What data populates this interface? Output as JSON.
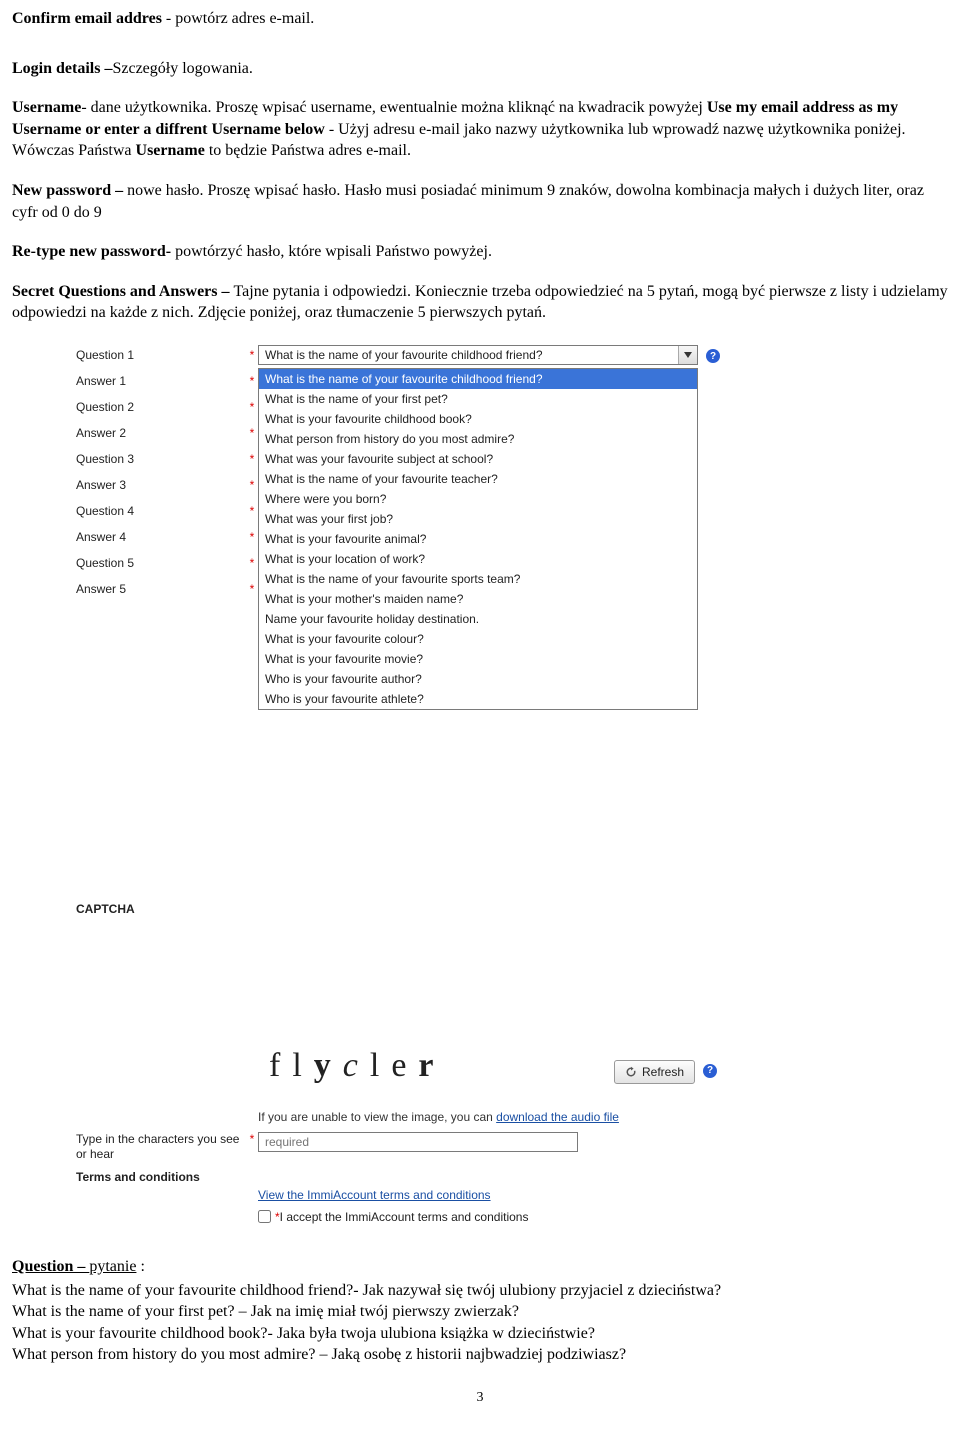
{
  "doc": {
    "line1_bold": "Confirm email addres",
    "line1_rest": " - powtórz adres e-mail.",
    "line2_bold": "Login details –",
    "line2_rest": "Szczegóły logowania.",
    "para3_prefix_bold": "Username",
    "para3_mid": "- dane użytkownika. Proszę wpisać username, ewentualnie można kliknąć na kwadracik powyżej ",
    "para3_bold2": "Use my email address as my Username or enter a diffrent Username below",
    "para3_mid2": " - Użyj adresu e-mail jako nazwy użytkownika lub wprowadź nazwę użytkownika poniżej. Wówczas Państwa ",
    "para3_bold3": "Username",
    "para3_rest": " to będzie Państwa adres e-mail.",
    "para4_bold": "New password – ",
    "para4_rest": "nowe hasło. Proszę wpisać hasło. Hasło musi posiadać minimum 9 znaków, dowolna kombinacja małych i dużych liter, oraz cyfr od 0 do 9",
    "para5_bold": "Re-type new password-",
    "para5_rest": " powtórzyć hasło, które wpisali Państwo powyżej.",
    "para6_bold": "Secret Questions and Answers – ",
    "para6_rest": "Tajne pytania i odpowiedzi. Koniecznie trzeba odpowiedzieć na 5 pytań, mogą być pierwsze z listy i udzielamy odpowiedzi na każde z nich. Zdjęcie poniżej, oraz tłumaczenie 5 pierwszych pytań.",
    "q_header_bold": "Question – ",
    "q_header_rest": "pytanie",
    "q_colon": " :",
    "q1": "What is the name of your favourite childhood friend?- Jak nazywał się twój ulubiony przyjaciel z dzieciństwa?",
    "q2": "What is the name of your first pet? – Jak na imię miał twój pierwszy zwierzak?",
    "q3": "What is your favourite childhood book?- Jaka była twoja ulubiona książka w dzieciństwie?",
    "q4": "What person from history do you most admire? – Jaką osobę z historii najbwadziej podziwiasz?",
    "page_num": "3"
  },
  "form": {
    "labels": [
      "Question 1",
      "Answer 1",
      "Question 2",
      "Answer 2",
      "Question 3",
      "Answer 3",
      "Question 4",
      "Answer 4",
      "Question 5",
      "Answer 5"
    ],
    "selected": "What is the name of your favourite childhood friend?",
    "options": [
      "What is the name of your favourite childhood friend?",
      "What is the name of your first pet?",
      "What is your favourite childhood book?",
      "What person from history do you most admire?",
      "What was your favourite subject at school?",
      "What is the name of your favourite teacher?",
      "Where were you born?",
      "What was your first job?",
      "What is your favourite animal?",
      "What is your location of work?",
      "What is the name of your favourite sports team?",
      "What is your mother's maiden name?",
      "Name your favourite holiday destination.",
      "What is your favourite colour?",
      "What is your favourite movie?",
      "Who is your favourite author?",
      "Who is your favourite athlete?"
    ],
    "captcha_header": "CAPTCHA",
    "captcha_text": "flycler",
    "refresh_label": "Refresh",
    "hint_prefix": "If you are unable to view the image, you can ",
    "hint_link": "download the audio file",
    "input_label": "Type in the characters you see or hear",
    "input_placeholder": "required",
    "terms_header": "Terms and conditions",
    "terms_link": "View the ImmiAccount terms and conditions",
    "accept_star": "*",
    "accept_text": " I accept the ImmiAccount terms and conditions"
  }
}
